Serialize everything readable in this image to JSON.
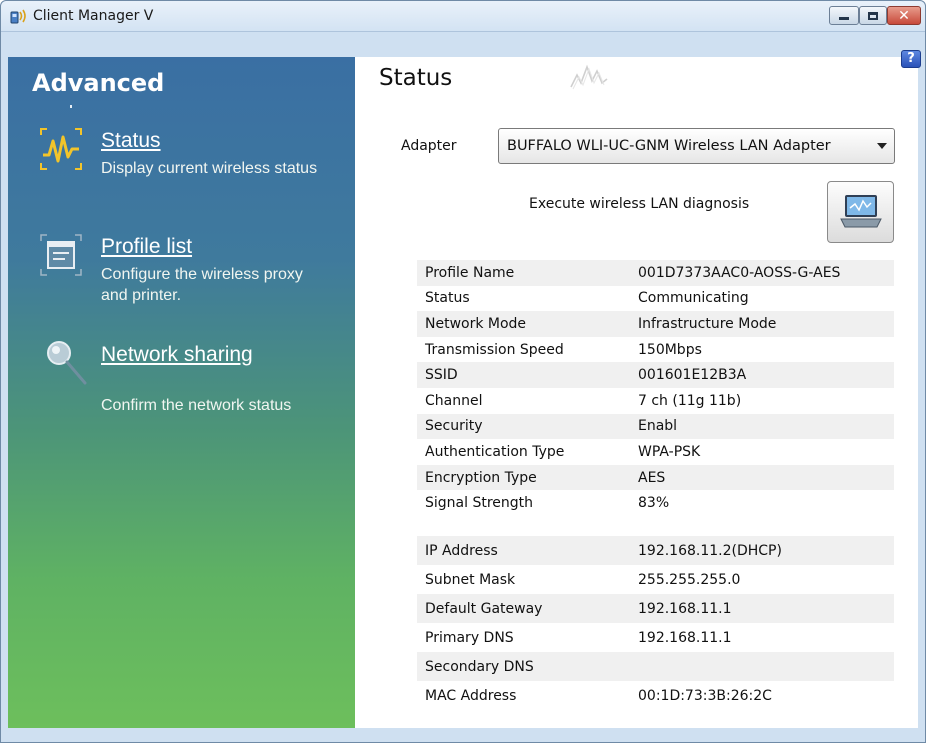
{
  "window": {
    "title": "Client Manager V"
  },
  "sidebar": {
    "heading": "Advanced",
    "items": [
      {
        "label": "Status",
        "description": "Display current wireless status",
        "icon": "wave-icon"
      },
      {
        "label": "Profile list",
        "description": "Configure the wireless proxy and printer.",
        "icon": "window-icon"
      },
      {
        "label": "Network sharing",
        "description": "Confirm the network status",
        "icon": "magnifier-icon"
      }
    ]
  },
  "main": {
    "title": "Status",
    "adapter_label": "Adapter",
    "adapter_value": "BUFFALO WLI-UC-GNM Wireless LAN Adapter",
    "diagnosis_label": "Execute wireless LAN diagnosis",
    "help_symbol": "?",
    "wireless_info": [
      {
        "label": "Profile Name",
        "value": "001D7373AAC0-AOSS-G-AES"
      },
      {
        "label": "Status",
        "value": "Communicating"
      },
      {
        "label": "Network Mode",
        "value": "Infrastructure Mode"
      },
      {
        "label": "Transmission Speed",
        "value": "150Mbps"
      },
      {
        "label": "SSID",
        "value": "001601E12B3A"
      },
      {
        "label": "Channel",
        "value": "7 ch (11g 11b)"
      },
      {
        "label": "Security",
        "value": "Enabl"
      },
      {
        "label": "Authentication Type",
        "value": "WPA-PSK"
      },
      {
        "label": "Encryption Type",
        "value": "AES"
      },
      {
        "label": "Signal Strength",
        "value": "83%"
      }
    ],
    "network_info": [
      {
        "label": "IP Address",
        "value": "192.168.11.2(DHCP)"
      },
      {
        "label": "Subnet Mask",
        "value": "255.255.255.0"
      },
      {
        "label": "Default Gateway",
        "value": "192.168.11.1"
      },
      {
        "label": "Primary DNS",
        "value": "192.168.11.1"
      },
      {
        "label": "Secondary DNS",
        "value": ""
      },
      {
        "label": "MAC Address",
        "value": "00:1D:73:3B:26:2C"
      }
    ]
  },
  "colors": {
    "sidebar_top": "#3a6fa3",
    "sidebar_bottom": "#6dbf5c",
    "title_bar": "#dce8f5",
    "close_button": "#c74a3b",
    "row_stripe": "#f0f0f0"
  }
}
